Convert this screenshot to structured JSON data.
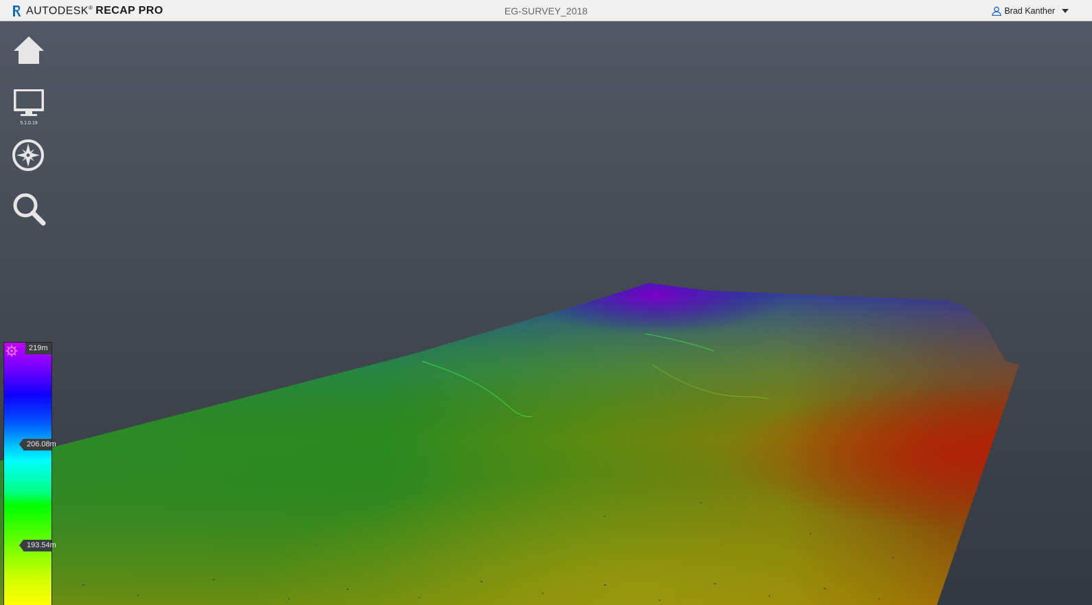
{
  "app": {
    "brand": "AUTODESK",
    "product": "RECAP PRO",
    "logo_letter": "R"
  },
  "document": {
    "title": "EG-SURVEY_2018"
  },
  "user": {
    "name": "Brad Kanther"
  },
  "toolbar": {
    "home_icon": "home-icon",
    "display_icon": "monitor-icon",
    "display_version": "5.1.0.19",
    "navigation_icon": "compass-icon",
    "search_icon": "magnifier-icon"
  },
  "elevation_legend": {
    "max_label": "219m",
    "mid_label": "206.08m",
    "low_label": "193.54m",
    "settings_icon": "gear-icon"
  },
  "colors": {
    "topbar_bg": "#f0f0f0",
    "viewport_bg_top": "#525964",
    "viewport_bg_bottom": "#343840",
    "logo_blue": "#0f6ab4"
  }
}
